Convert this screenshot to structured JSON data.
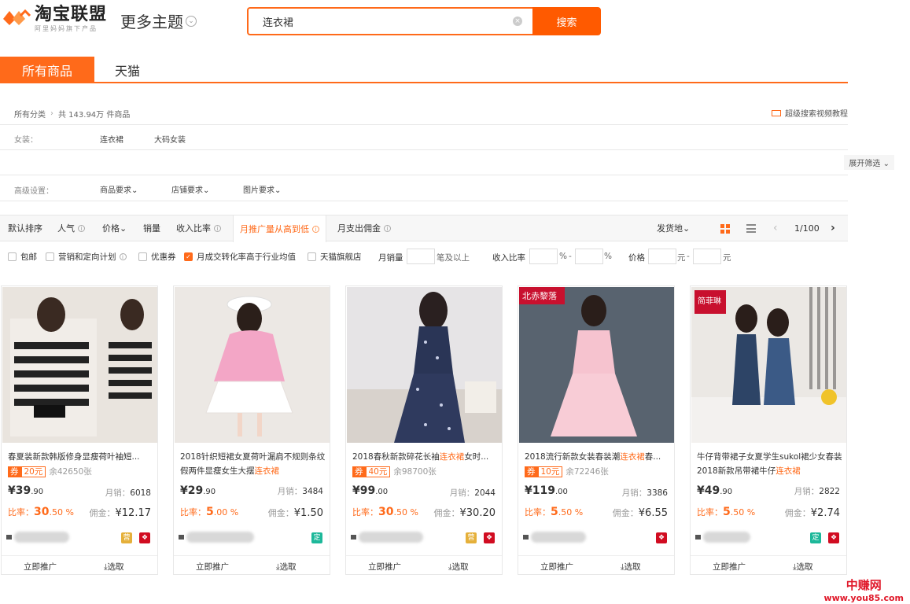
{
  "header": {
    "logo_title": "淘宝联盟",
    "logo_sub": "阿里妈妈旗下产品",
    "more_themes": "更多主题",
    "search_value": "连衣裙",
    "search_button": "搜索"
  },
  "tabs": [
    "所有商品",
    "天猫"
  ],
  "breadcrumb": {
    "root": "所有分类",
    "count": "共 143.94万 件商品"
  },
  "video_tutorial": "超级搜索视频教程",
  "category": {
    "label": "女装：",
    "items": [
      "连衣裙",
      "大码女装"
    ]
  },
  "expand_filter": "展开筛选",
  "advanced": {
    "label": "高级设置：",
    "items": [
      "商品要求",
      "店铺要求",
      "图片要求"
    ]
  },
  "sort": {
    "items": [
      "默认排序",
      "人气",
      "价格",
      "销量",
      "收入比率",
      "月推广量从高到低",
      "月支出佣金"
    ],
    "ship_from": "发货地",
    "pager": "1/100"
  },
  "filters": {
    "checkboxes": [
      "包邮",
      "营销和定向计划",
      "优惠券",
      "月成交转化率高于行业均值",
      "天猫旗舰店"
    ],
    "monthly_sales_label": "月销量",
    "monthly_sales_suffix": "笔及以上",
    "income_ratio_label": "收入比率",
    "percent": "%",
    "dash": "-",
    "price_label": "价格",
    "yuan": "元"
  },
  "products": [
    {
      "title_pre": "春夏装新款韩版修身显瘦荷叶袖短...",
      "title_hl": "",
      "title_post": "",
      "coupon_label": "券",
      "coupon_amount": "20元",
      "coupon_remaining": "余42650张",
      "price_int": "¥39",
      "price_dec": ".90",
      "monthly_label": "月销：",
      "monthly_value": "6018",
      "rate_label": "比率：",
      "rate_int": "30",
      "rate_dec": ".50 %",
      "commission_label": "佣金：",
      "commission_value": "¥12.17",
      "badges": [
        "营",
        "tm"
      ]
    },
    {
      "title_pre": "2018针织短裙女夏荷叶漏肩不规则条纹假两件显瘦女生大摆",
      "title_hl": "连衣裙",
      "title_post": "",
      "coupon_label": "",
      "coupon_amount": "",
      "coupon_remaining": "",
      "price_int": "¥29",
      "price_dec": ".90",
      "monthly_label": "月销：",
      "monthly_value": "3484",
      "rate_label": "比率：",
      "rate_int": "5",
      "rate_dec": ".00 %",
      "commission_label": "佣金：",
      "commission_value": "¥1.50",
      "badges": [
        "定"
      ]
    },
    {
      "title_pre": "2018春秋新款碎花长袖",
      "title_hl": "连衣裙",
      "title_post": "女时...",
      "coupon_label": "券",
      "coupon_amount": "40元",
      "coupon_remaining": "余98700张",
      "price_int": "¥99",
      "price_dec": ".00",
      "monthly_label": "月销：",
      "monthly_value": "2044",
      "rate_label": "比率：",
      "rate_int": "30",
      "rate_dec": ".50 %",
      "commission_label": "佣金：",
      "commission_value": "¥30.20",
      "badges": [
        "营",
        "tm"
      ]
    },
    {
      "title_pre": "2018流行新款女装春装潮",
      "title_hl": "连衣裙",
      "title_post": "春...",
      "coupon_label": "券",
      "coupon_amount": "10元",
      "coupon_remaining": "余72246张",
      "price_int": "¥119",
      "price_dec": ".00",
      "monthly_label": "月销：",
      "monthly_value": "3386",
      "rate_label": "比率：",
      "rate_int": "5",
      "rate_dec": ".50 %",
      "commission_label": "佣金：",
      "commission_value": "¥6.55",
      "badges": [
        "tm"
      ]
    },
    {
      "title_pre": "牛仔背带裙子女夏学生sukol裙少女春装2018新款吊带裙牛仔",
      "title_hl": "连衣裙",
      "title_post": "",
      "coupon_label": "",
      "coupon_amount": "",
      "coupon_remaining": "",
      "price_int": "¥49",
      "price_dec": ".90",
      "monthly_label": "月销：",
      "monthly_value": "2822",
      "rate_label": "比率：",
      "rate_int": "5",
      "rate_dec": ".50 %",
      "commission_label": "佣金：",
      "commission_value": "¥2.74",
      "badges": [
        "定",
        "tm"
      ]
    }
  ],
  "card_actions": {
    "promote": "立即推广",
    "select": "⤓选取"
  },
  "image_badges": {
    "card4_brand": "北赤黎落",
    "card5_brand": "简菲琳"
  },
  "watermark": {
    "cn": "中赚网",
    "url": "www.you85.com"
  },
  "colors": {
    "accent": "#ff6a1a",
    "tmall": "#d10c21"
  }
}
